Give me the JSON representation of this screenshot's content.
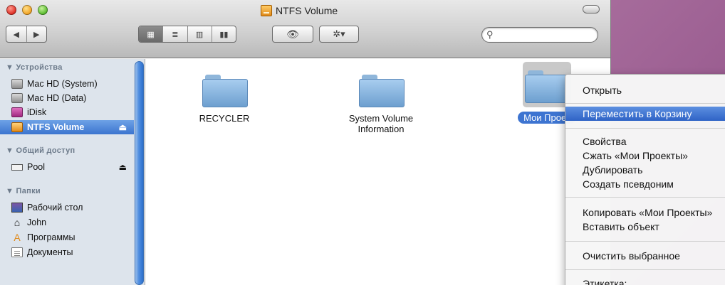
{
  "window": {
    "title": "NTFS Volume",
    "search_placeholder": ""
  },
  "toolbar": {
    "back_icon": "back-arrow",
    "forward_icon": "forward-arrow",
    "view_icon": "grid-view",
    "eye_icon": "quick-look",
    "action_icon": "gear"
  },
  "sidebar": {
    "devices_header": "▼ Устройства",
    "devices": [
      {
        "label": "Mac HD (System)"
      },
      {
        "label": "Mac HD (Data)"
      },
      {
        "label": "iDisk"
      },
      {
        "label": "NTFS Volume"
      }
    ],
    "shared_header": "▼ Общий доступ",
    "shared": [
      {
        "label": "Pool"
      }
    ],
    "places_header": "▼ Папки",
    "places": [
      {
        "label": "Рабочий стол"
      },
      {
        "label": "John"
      },
      {
        "label": "Программы"
      },
      {
        "label": "Документы"
      }
    ]
  },
  "files": [
    {
      "name": "RECYCLER"
    },
    {
      "name": "System Volume Information"
    },
    {
      "name": "Мои Проек"
    }
  ],
  "context_menu": {
    "items": [
      "Открыть",
      "Переместить в Корзину",
      "Свойства",
      "Сжать «Мои Проекты»",
      "Дублировать",
      "Создать псевдоним",
      "Копировать «Мои Проекты»",
      "Вставить объект",
      "Очистить выбранное",
      "Этикетка:"
    ]
  },
  "colors": {
    "selection": "#3d74d1",
    "sidebar_bg": "#dde4ec",
    "desktop": "#a06a9a"
  }
}
